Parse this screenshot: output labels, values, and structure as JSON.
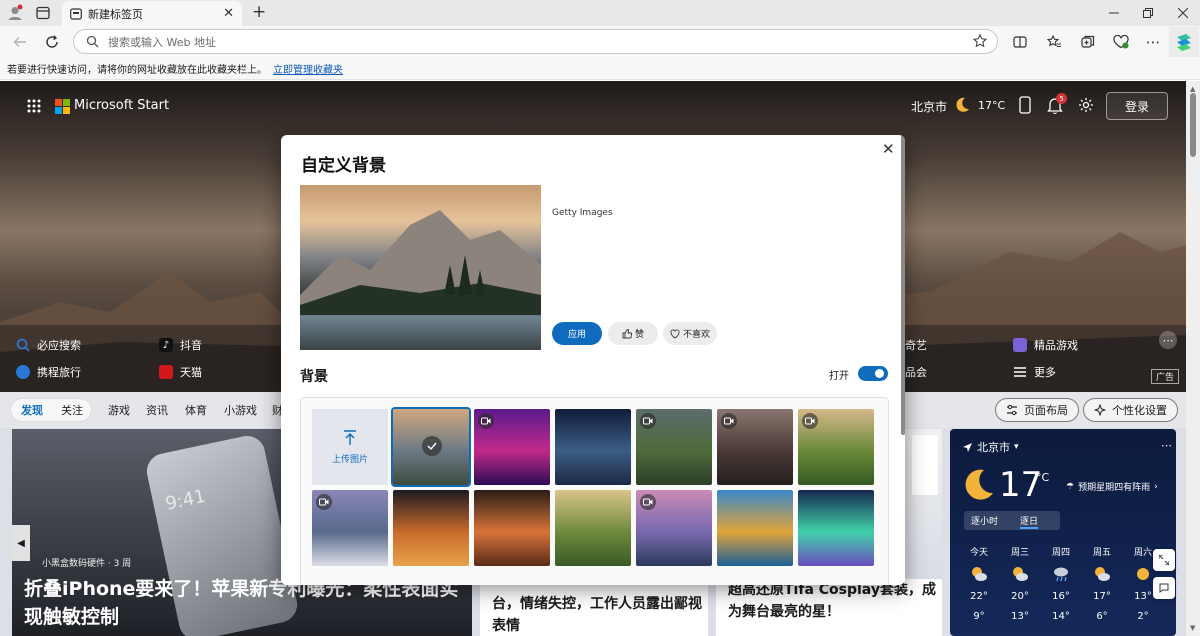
{
  "browser": {
    "tab_title": "新建标签页",
    "new_tab_symbol": "+",
    "address_placeholder": "搜索或输入 Web 地址",
    "favbar_text": "若要进行快速访问，请将你的网址收藏放在此收藏夹栏上。",
    "favbar_link": "立即管理收藏夹"
  },
  "msn": {
    "brand": "Microsoft Start",
    "city": "北京市",
    "temp": "17°C",
    "notification_count": "5",
    "login": "登录"
  },
  "quicklinks": [
    {
      "label": "必应搜索",
      "icon": "bing-search-icon",
      "color": "#2f7de1"
    },
    {
      "label": "抖音",
      "icon": "douyin-icon",
      "color": "#111111"
    },
    {
      "label": "携程旅行",
      "icon": "ctrip-icon",
      "color": "#2a77d6"
    },
    {
      "label": "天猫",
      "icon": "tmall-icon",
      "color": "#d4171c"
    },
    {
      "label": "奇艺",
      "icon": "iqiyi-icon",
      "color": "#2f2f2f"
    },
    {
      "label": "精品游戏",
      "icon": "game-icon",
      "color": "#7a62d8"
    },
    {
      "label": "品会",
      "icon": "vip-icon",
      "color": "#2f2f2f"
    },
    {
      "label": "更多",
      "icon": "menu-icon",
      "color": "#ffffff"
    }
  ],
  "ad_label": "广告",
  "nav_tabs": [
    "发现",
    "关注",
    "游戏",
    "资讯",
    "体育",
    "小游戏",
    "财"
  ],
  "layout_button": "页面布局",
  "personalize_button": "个性化设置",
  "news": {
    "main_source": "小黑盒数码硬件 · 3 周",
    "main_title": "折叠iPhone要来了！苹果新专利曝光：柔性表面实现触敏控制",
    "mid_title": "台，情绪失控，工作人员露出鄙视表情",
    "right_title": "超高还原Tifa Cosplay套装，成为舞台最亮的星！",
    "phone_time": "9:41"
  },
  "weather": {
    "city": "北京市",
    "temp": "17",
    "unit": "°C",
    "forecast_note": "预期星期四有阵雨",
    "tab_hourly": "逐小时",
    "tab_daily": "逐日",
    "days": [
      {
        "day": "今天",
        "high": "22°",
        "low": "9°",
        "icon": "sun-cloud-icon"
      },
      {
        "day": "周三",
        "high": "20°",
        "low": "13°",
        "icon": "sun-cloud-icon"
      },
      {
        "day": "周四",
        "high": "16°",
        "low": "14°",
        "icon": "rain-icon"
      },
      {
        "day": "周五",
        "high": "17°",
        "low": "6°",
        "icon": "sun-cloud-icon"
      },
      {
        "day": "周六",
        "high": "13°",
        "low": "2°",
        "icon": "sun-icon"
      }
    ]
  },
  "modal": {
    "title": "自定义背景",
    "credit": "Getty Images",
    "apply": "应用",
    "like": "赞",
    "dislike": "不喜欢",
    "section_title": "背景",
    "toggle_label": "打开",
    "toggle_on": true,
    "upload_label": "上传图片",
    "thumbnails": [
      {
        "name": "mountain-lake",
        "selected": true,
        "video": false,
        "colors": [
          "#cfa77e",
          "#6d7a86",
          "#3e4b3f"
        ]
      },
      {
        "name": "purple-pattern",
        "selected": false,
        "video": true,
        "colors": [
          "#5a1a8c",
          "#c22a8a",
          "#2b0b55"
        ]
      },
      {
        "name": "starry-mountain",
        "selected": false,
        "video": false,
        "colors": [
          "#0f1d3a",
          "#3c5d86",
          "#1b2a44"
        ]
      },
      {
        "name": "green-cliff",
        "selected": false,
        "video": true,
        "colors": [
          "#5d6d6d",
          "#4f6b3a",
          "#2d3f27"
        ]
      },
      {
        "name": "foggy-peaks",
        "selected": false,
        "video": true,
        "colors": [
          "#8a7670",
          "#4a3a36",
          "#23201e"
        ]
      },
      {
        "name": "terraced-field",
        "selected": false,
        "video": true,
        "colors": [
          "#d6b88a",
          "#6b8a3a",
          "#345a22"
        ]
      },
      {
        "name": "dusk-coast",
        "selected": false,
        "video": true,
        "colors": [
          "#8b86b8",
          "#586a8c",
          "#dcdce6"
        ]
      },
      {
        "name": "desert-dunes",
        "selected": false,
        "video": false,
        "colors": [
          "#1c1a22",
          "#c86b2a",
          "#e8a14a"
        ]
      },
      {
        "name": "sea-arch",
        "selected": false,
        "video": false,
        "colors": [
          "#2a1c16",
          "#d8743a",
          "#5a2c1a"
        ]
      },
      {
        "name": "green-hills",
        "selected": false,
        "video": false,
        "colors": [
          "#d9c48a",
          "#6f8a3e",
          "#3a5a26"
        ]
      },
      {
        "name": "pier-sunset",
        "selected": false,
        "video": true,
        "colors": [
          "#c98bb5",
          "#7a6ab0",
          "#2b3a5a"
        ]
      },
      {
        "name": "lone-tree",
        "selected": false,
        "video": false,
        "colors": [
          "#3b88c9",
          "#e0a43a",
          "#1c5f98"
        ]
      },
      {
        "name": "aurora",
        "selected": false,
        "video": false,
        "colors": [
          "#15284f",
          "#3fd1a9",
          "#6b4fbf"
        ]
      }
    ]
  }
}
